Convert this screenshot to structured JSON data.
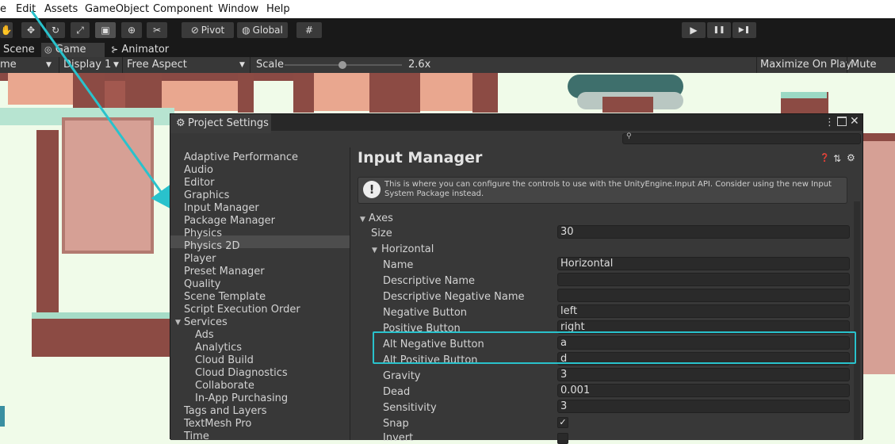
{
  "menu": {
    "items": [
      "e",
      "Edit",
      "Assets",
      "GameObject",
      "Component",
      "Window",
      "Help"
    ]
  },
  "toolbar": {
    "pivot": "Pivot",
    "global": "Global",
    "tools": [
      "hand-tool-icon",
      "move-tool-icon",
      "rotate-tool-icon",
      "scale-tool-icon",
      "rect-tool-icon",
      "transform-tool-icon",
      "custom-tool-icon"
    ],
    "play": "▶",
    "pause": "❚❚",
    "step": "▶❚"
  },
  "tabs": {
    "scene": "Scene",
    "game": "Game",
    "animator": "Animator"
  },
  "game_bar": {
    "mode": "me",
    "display": "Display 1",
    "aspect": "Free Aspect",
    "scale_label": "Scale",
    "scale_value": "2.6x",
    "scale_slider_fraction": 0.49,
    "maximize": "Maximize On Play",
    "mute": "Mute Aud"
  },
  "project_settings": {
    "title": "Project Settings",
    "search_placeholder": "",
    "nav": [
      {
        "label": "Adaptive Performance"
      },
      {
        "label": "Audio"
      },
      {
        "label": "Editor"
      },
      {
        "label": "Graphics"
      },
      {
        "label": "Input Manager",
        "selected": true
      },
      {
        "label": "Package Manager"
      },
      {
        "label": "Physics"
      },
      {
        "label": "Physics 2D"
      },
      {
        "label": "Player"
      },
      {
        "label": "Preset Manager"
      },
      {
        "label": "Quality"
      },
      {
        "label": "Scene Template"
      },
      {
        "label": "Script Execution Order"
      },
      {
        "label": "Services",
        "expanded": true
      },
      {
        "label": "Ads",
        "child": true
      },
      {
        "label": "Analytics",
        "child": true
      },
      {
        "label": "Cloud Build",
        "child": true
      },
      {
        "label": "Cloud Diagnostics",
        "child": true
      },
      {
        "label": "Collaborate",
        "child": true
      },
      {
        "label": "In-App Purchasing",
        "child": true
      },
      {
        "label": "Tags and Layers"
      },
      {
        "label": "TextMesh Pro"
      },
      {
        "label": "Time"
      }
    ],
    "panel": {
      "title": "Input Manager",
      "help_text": "This is where you can configure the controls to use with the UnityEngine.Input API. Consider using the new Input System Package instead.",
      "axes_label": "Axes",
      "size_label": "Size",
      "size_value": "30",
      "horizontal_label": "Horizontal",
      "fields": [
        {
          "label": "Name",
          "value": "Horizontal"
        },
        {
          "label": "Descriptive Name",
          "value": ""
        },
        {
          "label": "Descriptive Negative Name",
          "value": ""
        },
        {
          "label": "Negative Button",
          "value": "left"
        },
        {
          "label": "Positive Button",
          "value": "right"
        },
        {
          "label": "Alt Negative Button",
          "value": "a"
        },
        {
          "label": "Alt Positive Button",
          "value": "d"
        },
        {
          "label": "Gravity",
          "value": "3"
        },
        {
          "label": "Dead",
          "value": "0.001"
        },
        {
          "label": "Sensitivity",
          "value": "3"
        }
      ],
      "snap_label": "Snap",
      "snap_checked": "✓",
      "invert_label": "Invert"
    }
  },
  "colors": {
    "highlight": "#29c2cc",
    "arrow": "#29c2cc"
  }
}
